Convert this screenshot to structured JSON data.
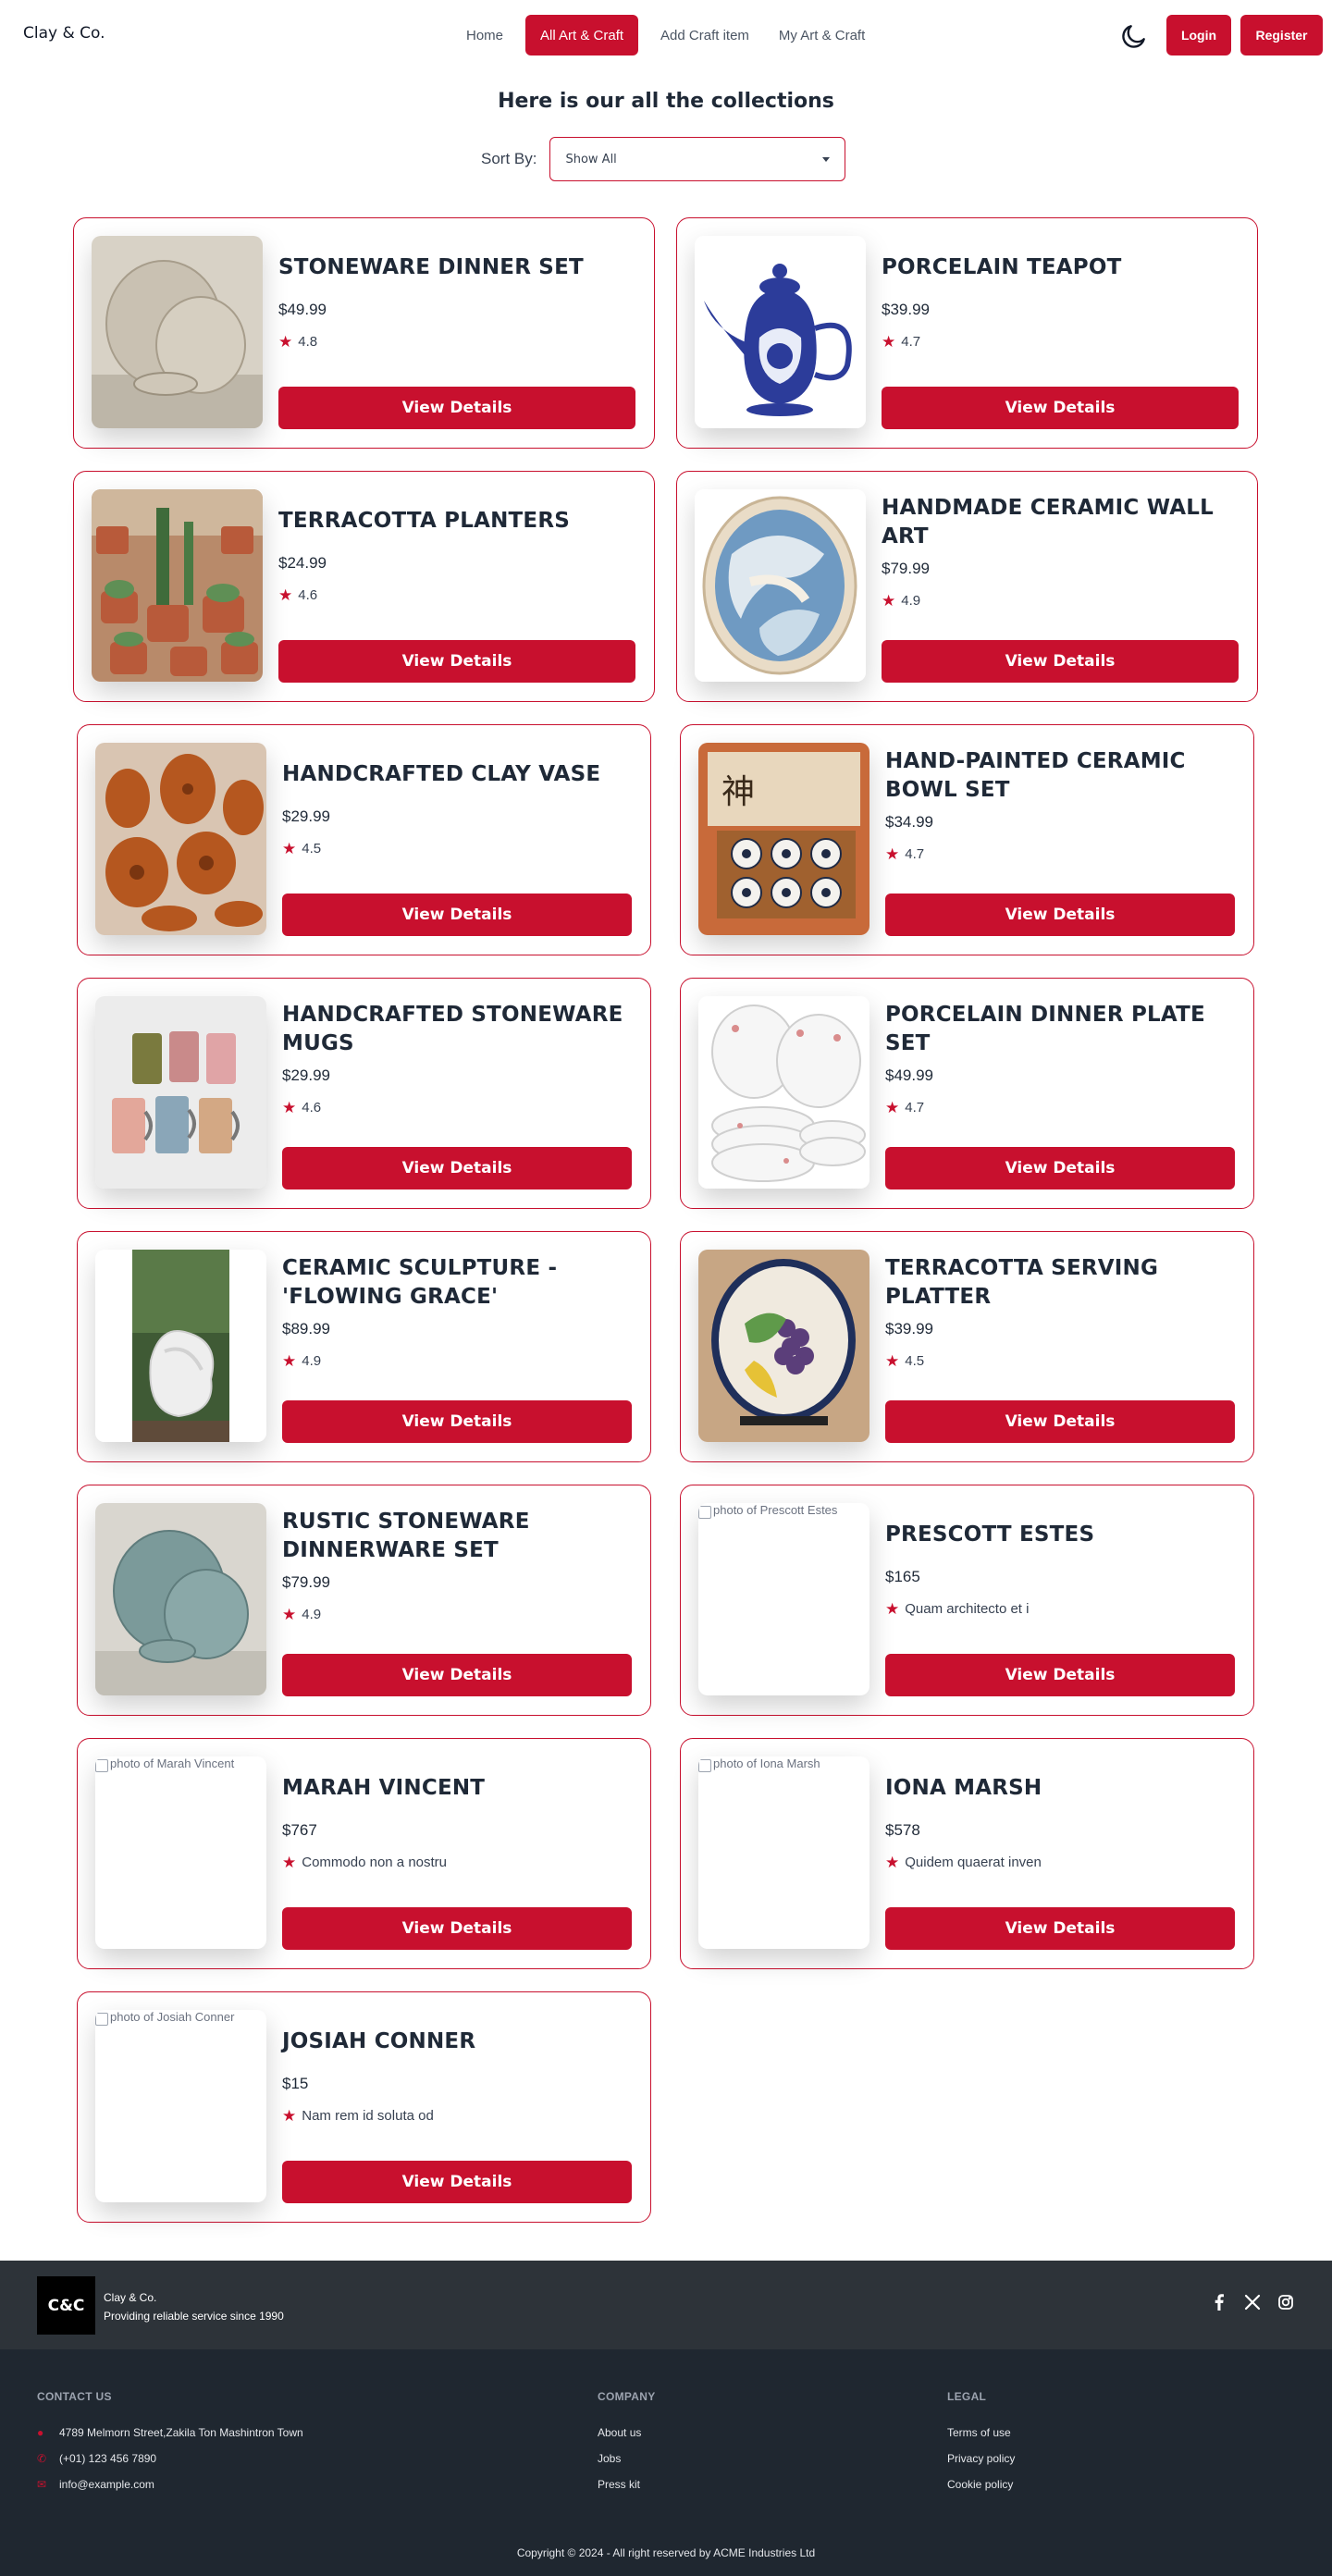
{
  "nav": {
    "brand": "Clay & Co.",
    "links": [
      "Home",
      "All Art & Craft",
      "Add Craft item",
      "My Art & Craft"
    ],
    "login": "Login",
    "register": "Register"
  },
  "header": {
    "title": "Here is our all the collections",
    "sort_label": "Sort By:",
    "sort_value": "Show All"
  },
  "view_details": "View Details",
  "items": [
    {
      "title": "Stoneware Dinner Set",
      "price": "$49.99",
      "rating": "4.8",
      "image": "stoneware-plates"
    },
    {
      "title": "Porcelain Teapot",
      "price": "$39.99",
      "rating": "4.7",
      "image": "blue-teapot"
    },
    {
      "title": "Terracotta Planters",
      "price": "$24.99",
      "rating": "4.6",
      "image": "planters"
    },
    {
      "title": "Handmade Ceramic Wall Art",
      "price": "$79.99",
      "rating": "4.9",
      "image": "wall-plate"
    },
    {
      "title": "Handcrafted Clay Vase",
      "price": "$29.99",
      "rating": "4.5",
      "image": "clay-vases"
    },
    {
      "title": "Hand-Painted Ceramic Bowl Set",
      "price": "$34.99",
      "rating": "4.7",
      "image": "bowl-box"
    },
    {
      "title": "Handcrafted Stoneware Mugs",
      "price": "$29.99",
      "rating": "4.6",
      "image": "mugs"
    },
    {
      "title": "Porcelain Dinner Plate Set",
      "price": "$49.99",
      "rating": "4.7",
      "image": "plate-stack"
    },
    {
      "title": "Ceramic Sculpture - 'Flowing Grace'",
      "price": "$89.99",
      "rating": "4.9",
      "image": "sculpture"
    },
    {
      "title": "Terracotta Serving Platter",
      "price": "$39.99",
      "rating": "4.5",
      "image": "platter"
    },
    {
      "title": "Rustic Stoneware Dinnerware Set",
      "price": "$79.99",
      "rating": "4.9",
      "image": "rustic-plates"
    },
    {
      "title": "Prescott Estes",
      "price": "$165",
      "rating": "Quam architecto et i",
      "alt": "photo of Prescott Estes"
    },
    {
      "title": "Marah Vincent",
      "price": "$767",
      "rating": "Commodo non a nostru",
      "alt": "photo of Marah Vincent"
    },
    {
      "title": "Iona Marsh",
      "price": "$578",
      "rating": "Quidem quaerat inven",
      "alt": "photo of Iona Marsh"
    },
    {
      "title": "Josiah Conner",
      "price": "$15",
      "rating": "Nam rem id soluta od",
      "alt": "photo of Josiah Conner"
    }
  ],
  "footer": {
    "logo_text": "C&C",
    "brand_name": "Clay & Co.",
    "tagline": "Providing reliable service since 1990",
    "contact_heading": "CONTACT US",
    "contact": [
      "4789 Melmorn Street,Zakila Ton Mashintron Town",
      "(+01) 123 456 7890",
      "info@example.com"
    ],
    "company_heading": "COMPANY",
    "company": [
      "About us",
      "Jobs",
      "Press kit"
    ],
    "legal_heading": "LEGAL",
    "legal": [
      "Terms of use",
      "Privacy policy",
      "Cookie policy"
    ],
    "copyright": "Copyright © 2024 - All right reserved by ACME Industries Ltd"
  },
  "colors": {
    "accent": "#c8102e",
    "footer_top": "#2d3339",
    "footer_main": "#1f2730"
  }
}
